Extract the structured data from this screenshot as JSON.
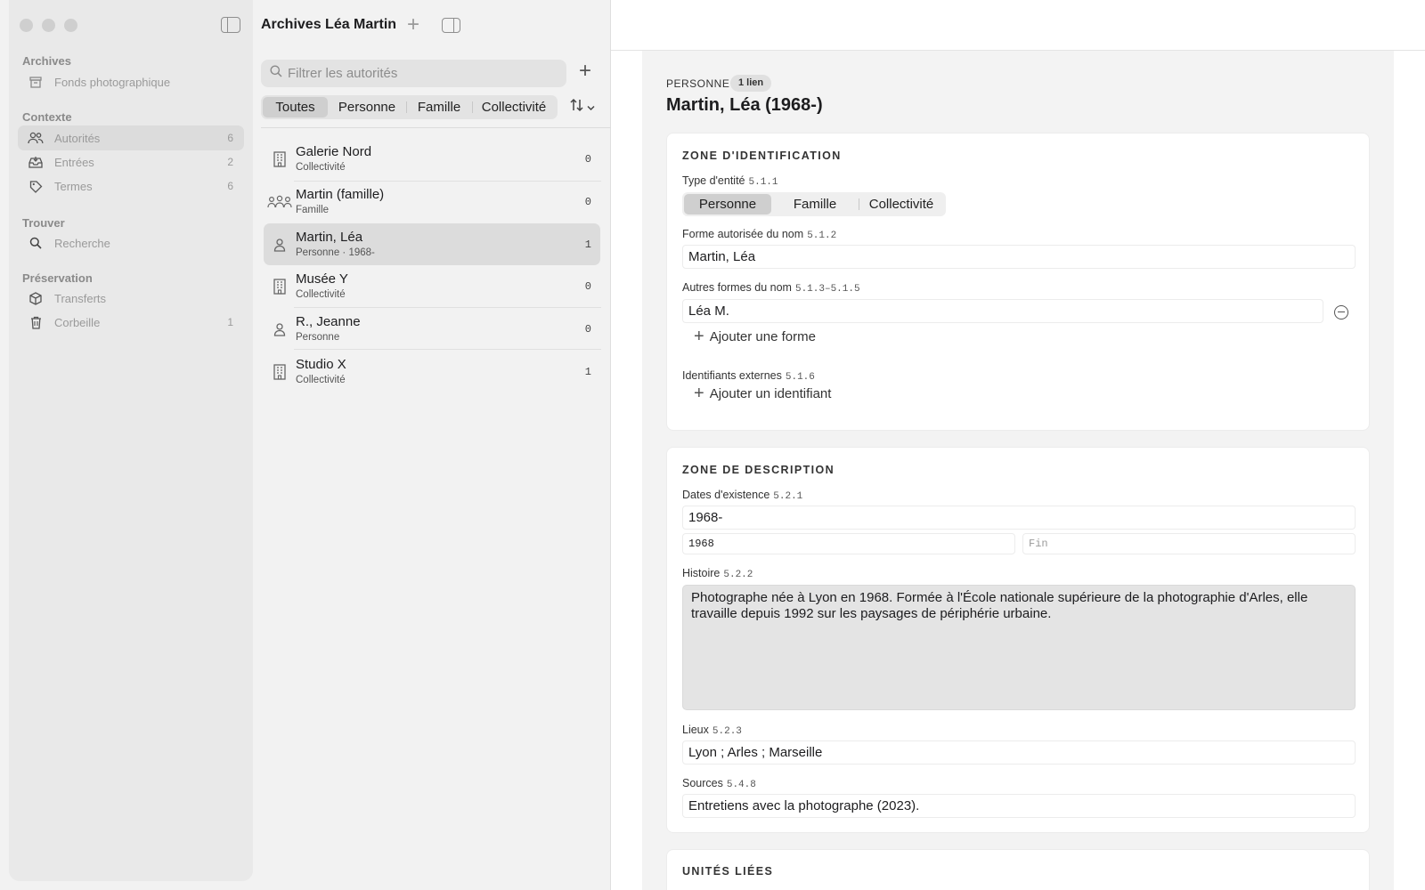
{
  "window": {
    "title": "Archives Léa Martin"
  },
  "sidebar": {
    "sections": [
      {
        "label": "Archives"
      },
      {
        "label": "Contexte"
      },
      {
        "label": "Trouver"
      },
      {
        "label": "Préservation"
      }
    ],
    "items": [
      {
        "label": "Fonds photographique",
        "icon": "archivebox-icon",
        "count": ""
      },
      {
        "label": "Autorités",
        "icon": "people-icon",
        "count": "6",
        "selected": true
      },
      {
        "label": "Entrées",
        "icon": "tray-icon",
        "count": "2"
      },
      {
        "label": "Termes",
        "icon": "tag-icon",
        "count": "6"
      },
      {
        "label": "Recherche",
        "icon": "search-icon",
        "count": ""
      },
      {
        "label": "Transferts",
        "icon": "cube-icon",
        "count": ""
      },
      {
        "label": "Corbeille",
        "icon": "trash-icon",
        "count": "1"
      }
    ]
  },
  "list": {
    "search_placeholder": "Filtrer les autorités",
    "filters": [
      "Toutes",
      "Personne",
      "Famille",
      "Collectivité"
    ],
    "active_filter": "Toutes",
    "rows": [
      {
        "title": "Galerie Nord",
        "subtitle": "Collectivité",
        "count": "0",
        "icon": "building-icon"
      },
      {
        "title": "Martin (famille)",
        "subtitle": "Famille",
        "count": "0",
        "icon": "group-icon"
      },
      {
        "title": "Martin, Léa",
        "subtitle": "Personne · 1968-",
        "count": "1",
        "icon": "person-icon",
        "selected": true
      },
      {
        "title": "Musée Y",
        "subtitle": "Collectivité",
        "count": "0",
        "icon": "building-icon"
      },
      {
        "title": "R., Jeanne",
        "subtitle": "Personne",
        "count": "0",
        "icon": "person-icon"
      },
      {
        "title": "Studio X",
        "subtitle": "Collectivité",
        "count": "1",
        "icon": "building-icon"
      }
    ]
  },
  "detail": {
    "kind": "PERSONNE",
    "badge": "1 lien",
    "title": "Martin, Léa (1968-)",
    "identification": {
      "heading": "ZONE D'IDENTIFICATION",
      "type_label": "Type d'entité",
      "type_code": "5.1.1",
      "type_options": [
        "Personne",
        "Famille",
        "Collectivité"
      ],
      "type_selected": "Personne",
      "name_label": "Forme autorisée du nom",
      "name_code": "5.1.2",
      "name_value": "Martin, Léa",
      "other_label": "Autres formes du nom",
      "other_code": "5.1.3–5.1.5",
      "other_value": "Léa M.",
      "add_form": "Ajouter une forme",
      "ext_label": "Identifiants externes",
      "ext_code": "5.1.6",
      "add_identifier": "Ajouter un identifiant"
    },
    "description": {
      "heading": "ZONE DE DESCRIPTION",
      "dates_label": "Dates d'existence",
      "dates_code": "5.2.1",
      "dates_value": "1968-",
      "start_value": "1968",
      "end_placeholder": "Fin",
      "history_label": "Histoire",
      "history_code": "5.2.2",
      "history_value": "Photographe née à Lyon en 1968. Formée à l'École nationale supérieure de la photographie d'Arles, elle travaille depuis 1992 sur les paysages de périphérie urbaine.",
      "places_label": "Lieux",
      "places_code": "5.2.3",
      "places_value": "Lyon ; Arles ; Marseille",
      "sources_label": "Sources",
      "sources_code": "5.4.8",
      "sources_value": "Entretiens avec la photographe (2023)."
    },
    "linked": {
      "heading": "UNITÉS LIÉES"
    }
  }
}
